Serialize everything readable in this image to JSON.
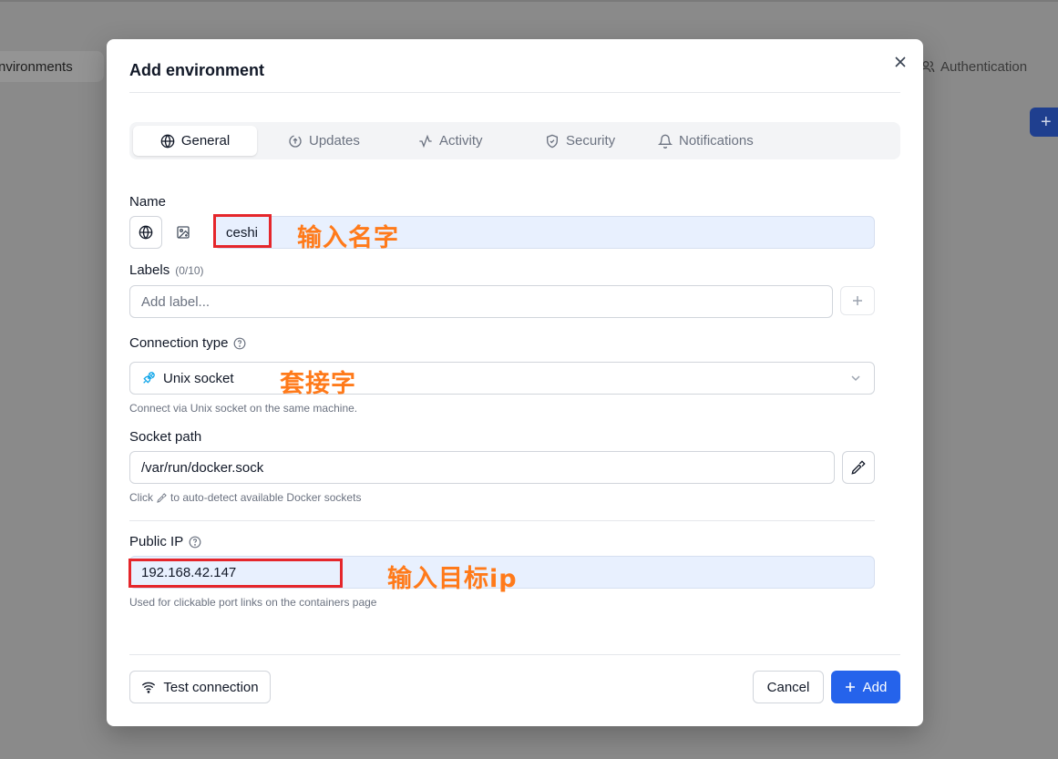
{
  "background": {
    "left_tab": "nvironments",
    "right_tab": "Authentication",
    "add_button": "+"
  },
  "modal": {
    "title": "Add environment",
    "tabs": [
      {
        "label": "General",
        "icon": "globe-icon",
        "active": true
      },
      {
        "label": "Updates",
        "icon": "refresh-upload-icon",
        "active": false
      },
      {
        "label": "Activity",
        "icon": "activity-icon",
        "active": false
      },
      {
        "label": "Security",
        "icon": "shield-icon",
        "active": false
      },
      {
        "label": "Notifications",
        "icon": "bell-icon",
        "active": false
      }
    ],
    "name": {
      "label": "Name",
      "value": "ceshi"
    },
    "labels": {
      "label": "Labels",
      "count": "(0/10)",
      "placeholder": "Add label..."
    },
    "connection_type": {
      "label": "Connection type",
      "value": "Unix socket",
      "hint": "Connect via Unix socket on the same machine."
    },
    "socket_path": {
      "label": "Socket path",
      "value": "/var/run/docker.sock",
      "hint_prefix": "Click",
      "hint_suffix": "to auto-detect available Docker sockets"
    },
    "public_ip": {
      "label": "Public IP",
      "value": "192.168.42.147",
      "hint": "Used for clickable port links on the containers page"
    },
    "footer": {
      "test_label": "Test connection",
      "cancel_label": "Cancel",
      "add_label": "Add"
    }
  },
  "annotations": {
    "name": "输入名字",
    "connection": "套接字",
    "ip": "输入目标ip"
  },
  "colors": {
    "primary": "#2563eb",
    "annotation": "#ff7a1a",
    "highlight_box": "#e5262b",
    "input_highlight": "#e8f0fe"
  }
}
